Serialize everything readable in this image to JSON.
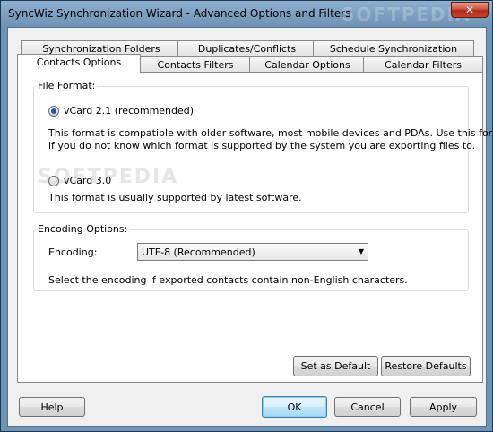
{
  "window": {
    "title": "SyncWiz Synchronization Wizard - Advanced Options and Filters",
    "close_label": "✕"
  },
  "tabs": {
    "row1": [
      "Synchronization Folders",
      "Duplicates/Conflicts",
      "Schedule Synchronization"
    ],
    "row2": [
      "Contacts Options",
      "Contacts Filters",
      "Calendar Options",
      "Calendar Filters"
    ]
  },
  "file_format": {
    "label": "File Format:",
    "vcard21": {
      "label": "vCard 2.1 (recommended)",
      "selected": true,
      "desc1": "This format is compatible with older software, most mobile devices and PDAs. Use this format",
      "desc2": "if you do not know which format is supported by the system you are exporting files to."
    },
    "vcard30": {
      "label": "vCard 3.0",
      "selected": false,
      "desc": "This format is usually supported by latest software."
    }
  },
  "encoding": {
    "group_label": "Encoding Options:",
    "field_label": "Encoding:",
    "value": "UTF-8 (Recommended)",
    "hint": "Select the encoding if exported contacts contain non-English characters."
  },
  "panel_buttons": {
    "set_default": "Set as Default",
    "restore_defaults": "Restore Defaults"
  },
  "footer": {
    "help": "Help",
    "ok": "OK",
    "cancel": "Cancel",
    "apply": "Apply"
  },
  "watermarks": {
    "title_bar": "SOFTPEDIA",
    "panel": "SOFTPEDIA"
  },
  "icons": {
    "close": "close-icon",
    "dropdown": "chevron-down-icon"
  }
}
